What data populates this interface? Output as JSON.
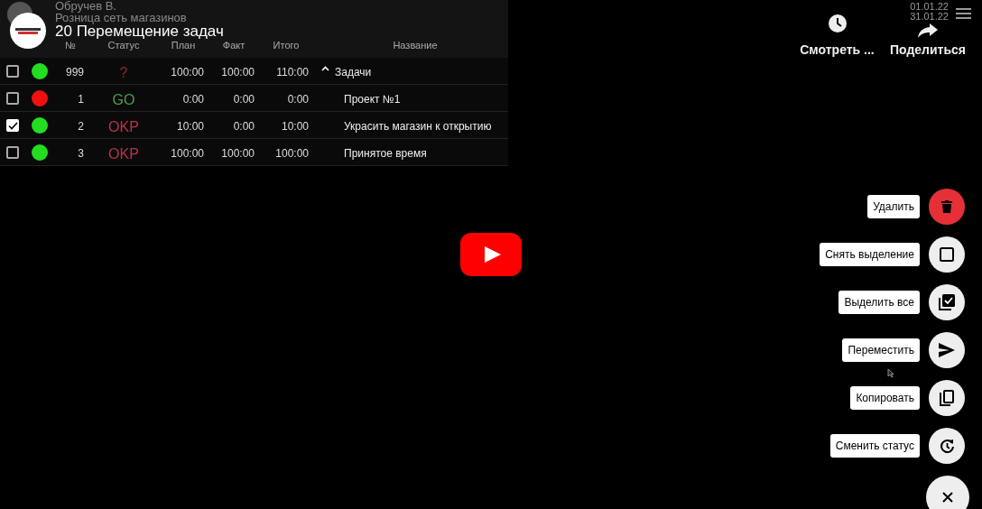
{
  "video": {
    "title": "20 Перемещение задач",
    "actions": [
      {
        "kind": "clock",
        "label": "Смотреть ..."
      },
      {
        "kind": "share",
        "label": "Поделиться"
      }
    ]
  },
  "app": {
    "user": "Обручев В.",
    "org": "Розница сеть магазинов",
    "dates": [
      "01.01.22",
      "31.01.22"
    ],
    "table": {
      "columns": [
        "№",
        "Статус",
        "План",
        "Факт",
        "Итого",
        "Название"
      ],
      "rows": [
        {
          "checked": false,
          "color": "#22dd22",
          "number": "999",
          "status": {
            "text": "?",
            "color": "#8b2a2a"
          },
          "plan": "100:00",
          "fact": "100:00",
          "total": "110:00",
          "name": "Задачи",
          "expanded": true,
          "children": [
            {
              "checked": false,
              "color": "#ee1111",
              "number": "1",
              "status": {
                "text": "GO",
                "color": "#4f9a55"
              },
              "plan": "0:00",
              "fact": "0:00",
              "total": "0:00",
              "name": "Проект №1"
            },
            {
              "checked": true,
              "color": "#22dd22",
              "number": "2",
              "status": {
                "text": "OKP",
                "color": "#b8334a"
              },
              "plan": "10:00",
              "fact": "0:00",
              "total": "10:00",
              "name": "Украсить магазин к открытию"
            },
            {
              "checked": false,
              "color": "#22dd22",
              "number": "3",
              "status": {
                "text": "OKP",
                "color": "#b8334a"
              },
              "plan": "100:00",
              "fact": "100:00",
              "total": "100:00",
              "name": "Принятое время"
            }
          ]
        }
      ]
    }
  },
  "fab": {
    "items": [
      {
        "kind": "delete",
        "label": "Удалить"
      },
      {
        "kind": "deselect",
        "label": "Снять выделение"
      },
      {
        "kind": "select_all",
        "label": "Выделить все"
      },
      {
        "kind": "move",
        "label": "Переместить"
      },
      {
        "kind": "copy",
        "label": "Копировать"
      },
      {
        "kind": "status",
        "label": "Сменить статус"
      }
    ]
  }
}
